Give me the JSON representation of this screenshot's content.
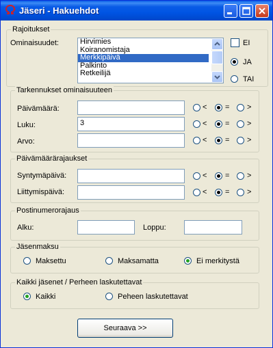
{
  "window": {
    "title": "Jäseri - Hakuehdot"
  },
  "rajoitukset": {
    "legend": "Rajoitukset",
    "ominaisuudet_label": "Ominaisuudet:",
    "list_items": [
      "Hirvimies",
      "Koiranomistaja",
      "Merkkipäivä",
      "Palkinto",
      "Retkeilijä"
    ],
    "selected_item": "Merkkipäivä",
    "ei_label": "EI",
    "ja_label": "JA",
    "tai_label": "TAI"
  },
  "tarkennukset": {
    "legend": "Tarkennukset ominaisuuteen",
    "rows": [
      {
        "label": "Päivämäärä:",
        "value": ""
      },
      {
        "label": "Luku:",
        "value": "3"
      },
      {
        "label": "Arvo:",
        "value": ""
      }
    ]
  },
  "paivamaararajaukset": {
    "legend": "Päivämäärärajaukset",
    "rows": [
      {
        "label": "Syntymäpäivä:",
        "value": ""
      },
      {
        "label": "Liittymispäivä:",
        "value": ""
      }
    ]
  },
  "compare": {
    "lt": "<",
    "eq": "=",
    "gt": ">"
  },
  "postinumero": {
    "legend": "Postinumerorajaus",
    "alku_label": "Alku:",
    "loppu_label": "Loppu:",
    "alku_value": "",
    "loppu_value": ""
  },
  "jasenmaksu": {
    "legend": "Jäsenmaksu",
    "options": [
      "Maksettu",
      "Maksamatta",
      "Ei merkitystä"
    ],
    "selected": "Ei merkitystä"
  },
  "laskutus": {
    "legend": "Kaikki jäsenet / Perheen laskutettavat",
    "options": [
      "Kaikki",
      "Peheen laskutettavat"
    ],
    "selected": "Kaikki"
  },
  "next_button": "Seuraava >>",
  "colors": {
    "selection": "#316ac5",
    "titlebar": "#0054e3",
    "radio_dot": "#21a121"
  }
}
